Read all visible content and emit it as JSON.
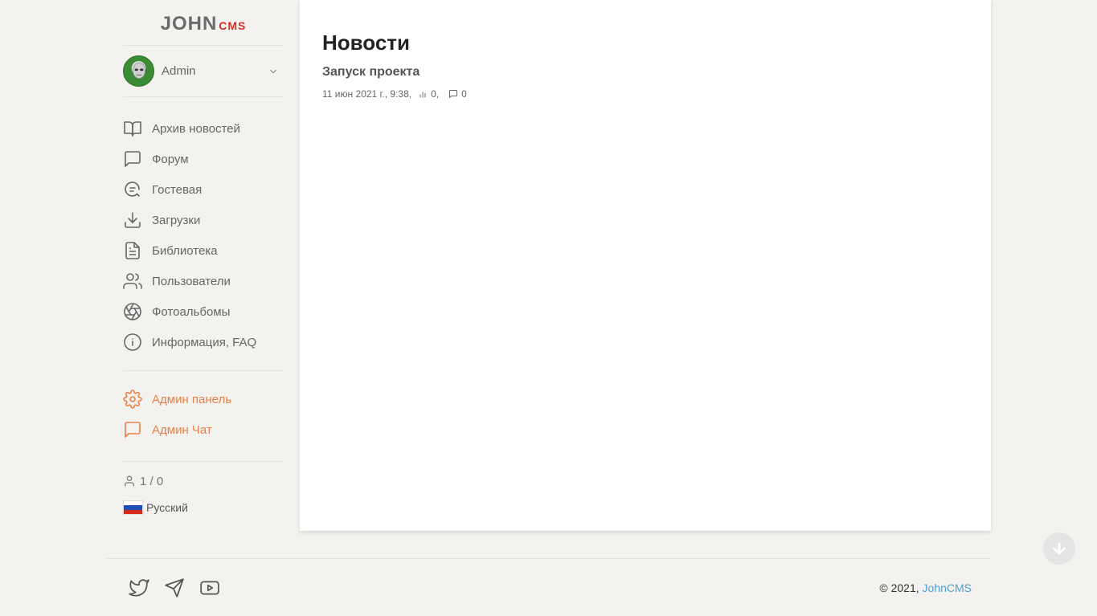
{
  "logo": {
    "main": "JOHN",
    "suffix": "CMS"
  },
  "user": {
    "name": "Admin"
  },
  "menu": [
    {
      "label": "Архив новостей",
      "icon": "book-icon"
    },
    {
      "label": "Форум",
      "icon": "message-square-icon"
    },
    {
      "label": "Гостевая",
      "icon": "guestbook-icon"
    },
    {
      "label": "Загрузки",
      "icon": "download-icon"
    },
    {
      "label": "Библиотека",
      "icon": "file-text-icon"
    },
    {
      "label": "Пользователи",
      "icon": "users-icon"
    },
    {
      "label": "Фотоальбомы",
      "icon": "aperture-icon"
    },
    {
      "label": "Информация, FAQ",
      "icon": "info-icon"
    }
  ],
  "admin_menu": [
    {
      "label": "Админ панель",
      "icon": "gear-icon"
    },
    {
      "label": "Админ Чат",
      "icon": "message-square-icon"
    }
  ],
  "stats": {
    "online": "1 / 0"
  },
  "language": {
    "label": "Русский"
  },
  "page": {
    "title": "Новости",
    "news": {
      "title": "Запуск проекта",
      "date": "11 июн 2021 г., 9:38,",
      "views": "0,",
      "comments": "0"
    }
  },
  "footer": {
    "copyright_prefix": "© 2021,",
    "copyright_link": "JohnCMS"
  },
  "colors": {
    "accent": "#e88148",
    "link": "#4a9fd8",
    "background": "#f3f2ef"
  }
}
